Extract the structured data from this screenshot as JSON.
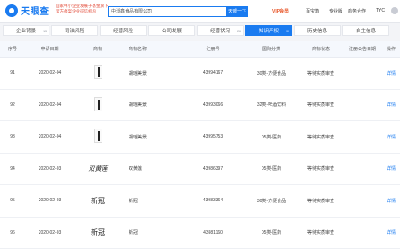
{
  "header": {
    "logo_text": "天眼查",
    "promo_line1": "国家中小企业发展子基金旗下",
    "promo_line2": "官方备案企业征信机构",
    "search_value": "中沃鑫食品有限公司",
    "search_button": "天眼一下",
    "vip_label": "VIP会员",
    "nav_items": [
      "百宝箱",
      "专业版",
      "商务合作",
      "TYC"
    ]
  },
  "tabs": [
    {
      "label": "企业背景",
      "count": "13"
    },
    {
      "label": "司法风险",
      "count": ""
    },
    {
      "label": "经营风险",
      "count": ""
    },
    {
      "label": "公司发展",
      "count": ""
    },
    {
      "label": "经营状况",
      "count": "26"
    },
    {
      "label": "知识产权",
      "count": "30"
    },
    {
      "label": "历史信息",
      "count": ""
    },
    {
      "label": "自主信息",
      "count": ""
    }
  ],
  "table": {
    "headers": [
      "序号",
      "申请日期",
      "商标",
      "商标名称",
      "注册号",
      "国际分类",
      "商标状态",
      "注册公告日期",
      "操作"
    ],
    "rows": [
      {
        "num": "91",
        "date": "2020-02-04",
        "mark": "image",
        "name": "湖瑶美景",
        "reg": "43994167",
        "class": "30类-方便食品",
        "status": "等待实质审查",
        "notice": "",
        "action": "详情"
      },
      {
        "num": "92",
        "date": "2020-02-04",
        "mark": "image",
        "name": "湖瑶美景",
        "reg": "43993066",
        "class": "32类-啤酒饮料",
        "status": "等待实质审查",
        "notice": "",
        "action": "详情"
      },
      {
        "num": "93",
        "date": "2020-02-04",
        "mark": "image",
        "name": "湖瑶美景",
        "reg": "43995753",
        "class": "05类-医药",
        "status": "等待实质审查",
        "notice": "",
        "action": "详情"
      },
      {
        "num": "94",
        "date": "2020-02-03",
        "mark": "script",
        "mark_text": "双黄莲",
        "name": "双黄莲",
        "reg": "43986397",
        "class": "05类-医药",
        "status": "等待实质审查",
        "notice": "",
        "action": "详情"
      },
      {
        "num": "95",
        "date": "2020-02-03",
        "mark": "text",
        "mark_text": "新冠",
        "name": "新冠",
        "reg": "43983364",
        "class": "30类-方便食品",
        "status": "等待实质审查",
        "notice": "",
        "action": "详情"
      },
      {
        "num": "96",
        "date": "2020-02-03",
        "mark": "text",
        "mark_text": "新冠",
        "name": "新冠",
        "reg": "43981160",
        "class": "05类-医药",
        "status": "等待实质审查",
        "notice": "",
        "action": "详情"
      }
    ]
  }
}
